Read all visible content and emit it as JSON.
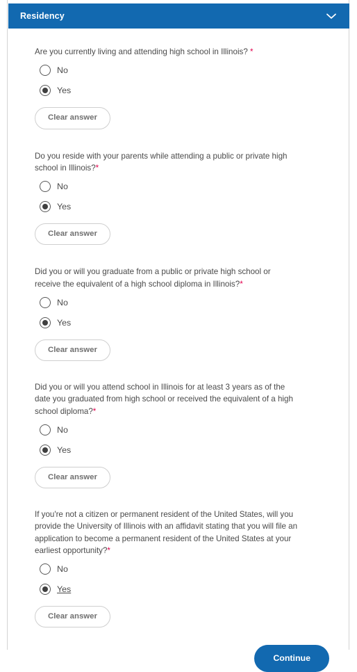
{
  "section": {
    "title": "Residency",
    "collapse_icon": "chevron-down-icon",
    "header_color": "#1269b0"
  },
  "colors": {
    "accent": "#1269b0",
    "required_marker": "#e0004d",
    "text": "#4a4a4a",
    "button_border": "#cfcfcf"
  },
  "questions": [
    {
      "text": "Are you currently living and attending high school in Illinois?",
      "required_marker": " *",
      "options": [
        {
          "label": "No",
          "selected": false
        },
        {
          "label": "Yes",
          "selected": true
        }
      ],
      "clear_label": "Clear answer"
    },
    {
      "text": "Do you reside with your parents while attending a public or private high school in Illinois?",
      "required_marker": "*",
      "options": [
        {
          "label": "No",
          "selected": false
        },
        {
          "label": "Yes",
          "selected": true
        }
      ],
      "clear_label": "Clear answer"
    },
    {
      "text": "Did you or will you graduate from a public or private high school or receive the equivalent of a high school diploma in Illinois?",
      "required_marker": "*",
      "options": [
        {
          "label": "No",
          "selected": false
        },
        {
          "label": "Yes",
          "selected": true
        }
      ],
      "clear_label": "Clear answer"
    },
    {
      "text": "Did you or will you attend school in Illinois for at least 3 years as of the date you graduated from high school or received the equivalent of a high school diploma?",
      "required_marker": "*",
      "options": [
        {
          "label": "No",
          "selected": false
        },
        {
          "label": "Yes",
          "selected": true
        }
      ],
      "clear_label": "Clear answer"
    },
    {
      "text": "If you're not a citizen or permanent resident of the United States, will you provide the University of Illinois with an affidavit stating that you will file an application to become a permanent resident of the United States at your earliest opportunity?",
      "required_marker": "*",
      "options": [
        {
          "label": "No",
          "selected": false
        },
        {
          "label": "Yes",
          "selected": true,
          "focused": true
        }
      ],
      "clear_label": "Clear answer"
    }
  ],
  "footer": {
    "continue_label": "Continue"
  }
}
